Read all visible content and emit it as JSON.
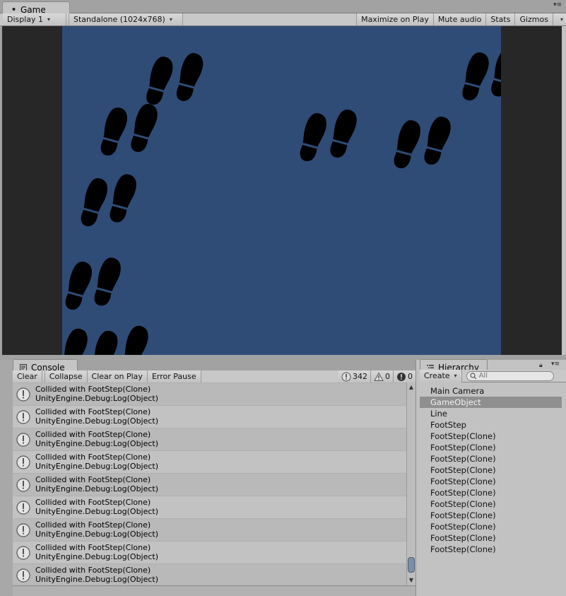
{
  "game_tab": {
    "title": "Game"
  },
  "game_toolbar": {
    "display": "Display 1",
    "resolution": "Standalone (1024x768)",
    "maximize": "Maximize on Play",
    "mute": "Mute audio",
    "stats": "Stats",
    "gizmos": "Gizmos"
  },
  "console": {
    "title": "Console",
    "clear": "Clear",
    "collapse": "Collapse",
    "clear_on_play": "Clear on Play",
    "error_pause": "Error Pause",
    "log_count": "342",
    "warn_count": "0",
    "error_count": "0",
    "entries": [
      {
        "line1": "Collided with FootStep(Clone)",
        "line2": "UnityEngine.Debug:Log(Object)"
      },
      {
        "line1": "Collided with FootStep(Clone)",
        "line2": "UnityEngine.Debug:Log(Object)"
      },
      {
        "line1": "Collided with FootStep(Clone)",
        "line2": "UnityEngine.Debug:Log(Object)"
      },
      {
        "line1": "Collided with FootStep(Clone)",
        "line2": "UnityEngine.Debug:Log(Object)"
      },
      {
        "line1": "Collided with FootStep(Clone)",
        "line2": "UnityEngine.Debug:Log(Object)"
      },
      {
        "line1": "Collided with FootStep(Clone)",
        "line2": "UnityEngine.Debug:Log(Object)"
      },
      {
        "line1": "Collided with FootStep(Clone)",
        "line2": "UnityEngine.Debug:Log(Object)"
      },
      {
        "line1": "Collided with FootStep(Clone)",
        "line2": "UnityEngine.Debug:Log(Object)"
      },
      {
        "line1": "Collided with FootStep(Clone)",
        "line2": "UnityEngine.Debug:Log(Object)"
      }
    ]
  },
  "hierarchy": {
    "title": "Hierarchy",
    "create": "Create",
    "search_placeholder": "All",
    "items": [
      {
        "label": "Main Camera",
        "selected": false
      },
      {
        "label": "GameObject",
        "selected": true
      },
      {
        "label": "Line",
        "selected": false
      },
      {
        "label": "FootStep",
        "selected": false
      },
      {
        "label": "FootStep(Clone)",
        "selected": false
      },
      {
        "label": "FootStep(Clone)",
        "selected": false
      },
      {
        "label": "FootStep(Clone)",
        "selected": false
      },
      {
        "label": "FootStep(Clone)",
        "selected": false
      },
      {
        "label": "FootStep(Clone)",
        "selected": false
      },
      {
        "label": "FootStep(Clone)",
        "selected": false
      },
      {
        "label": "FootStep(Clone)",
        "selected": false
      },
      {
        "label": "FootStep(Clone)",
        "selected": false
      },
      {
        "label": "FootStep(Clone)",
        "selected": false
      },
      {
        "label": "FootStep(Clone)",
        "selected": false
      },
      {
        "label": "FootStep(Clone)",
        "selected": false
      }
    ]
  },
  "colors": {
    "game_background": "#2f4c76",
    "footprint": "#000000",
    "selected_row": "#8f8f8f"
  }
}
